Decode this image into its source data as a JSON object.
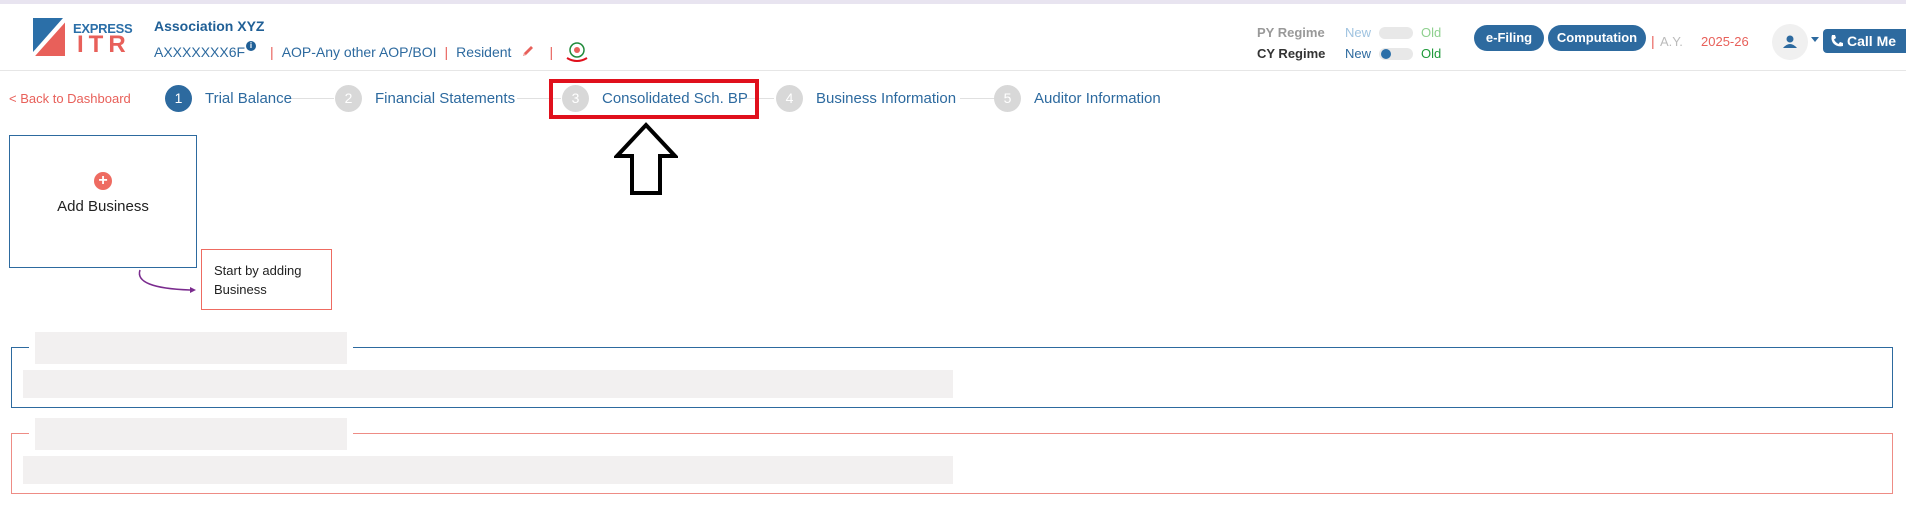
{
  "app": {
    "logo_top": "EXPRESS",
    "logo_bottom": "ITR"
  },
  "assessee": {
    "name": "Association XYZ",
    "pan": "AXXXXXXX6F",
    "info_glyph": "i",
    "status": "AOP-Any other AOP/BOI",
    "residency": "Resident",
    "separator": "|"
  },
  "regime": {
    "py_label": "PY Regime",
    "cy_label": "CY Regime",
    "new_label": "New",
    "old_label": "Old"
  },
  "actions": {
    "efiling": "e-Filing",
    "computation": "Computation",
    "ay_label": "A.Y.",
    "ay_value": "2025-26",
    "call_me": "Call Me"
  },
  "nav": {
    "back": "< Back to Dashboard",
    "steps": [
      {
        "num": "1",
        "label": "Trial Balance"
      },
      {
        "num": "2",
        "label": "Financial Statements"
      },
      {
        "num": "3",
        "label": "Consolidated Sch. BP"
      },
      {
        "num": "4",
        "label": "Business Information"
      },
      {
        "num": "5",
        "label": "Auditor Information"
      }
    ]
  },
  "main": {
    "add_business_icon": "+",
    "add_business_label": "Add Business",
    "hint": "Start by adding Business"
  },
  "colors": {
    "primary": "#2d6a9f",
    "accent": "#e8605a",
    "highlight": "#e0101c",
    "placeholder": "#f2f0f0"
  }
}
